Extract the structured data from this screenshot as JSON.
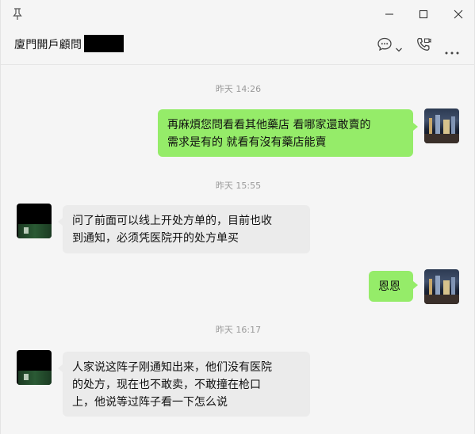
{
  "window": {
    "title": "廈門開戶顧問"
  },
  "header": {
    "icons": [
      "chat-bubble-icon",
      "chevron-down-icon",
      "phone-video-icon",
      "more-icon"
    ]
  },
  "messages": [
    {
      "type": "timestamp",
      "text": "昨天 14:26"
    },
    {
      "type": "self",
      "lines": [
        "再麻煩您問看看其他藥店  看哪家還敢賣的",
        "需求是有的  就看有沒有藥店能賣"
      ]
    },
    {
      "type": "timestamp",
      "text": "昨天 15:55"
    },
    {
      "type": "other",
      "lines": [
        "问了前面可以线上开处方单的，目前也收",
        "到通知，必须凭医院开的处方单买"
      ]
    },
    {
      "type": "self",
      "lines": [
        "恩恩"
      ]
    },
    {
      "type": "timestamp",
      "text": "昨天 16:17"
    },
    {
      "type": "other",
      "lines": [
        "人家说这阵子刚通知出来，他们没有医院",
        "的处方，现在也不敢卖，不敢撞在枪口",
        "上，他说等过阵子看一下怎么说"
      ]
    }
  ],
  "colors": {
    "self_bubble": "#95ec69",
    "other_bubble": "#ebebeb",
    "background": "#f5f5f5"
  }
}
